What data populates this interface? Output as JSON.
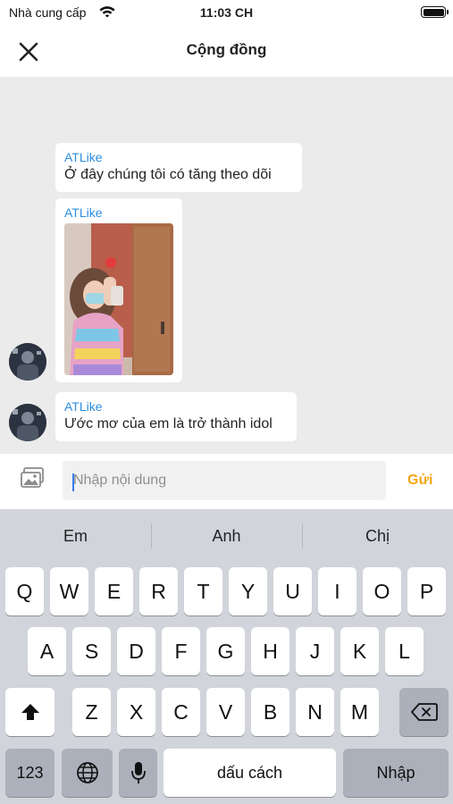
{
  "status_bar": {
    "carrier": "Nhà cung cấp",
    "time": "11:03 CH"
  },
  "nav": {
    "title": "Cộng đồng",
    "close_icon": "close-icon"
  },
  "messages": [
    {
      "sender": "ATLike",
      "text": "Ở đây chúng tôi có tăng theo dõi"
    },
    {
      "sender": "ATLike",
      "type": "image"
    },
    {
      "sender": "ATLike",
      "text": "Ước mơ của em là trở thành idol"
    }
  ],
  "composer": {
    "placeholder": "Nhập nội dung",
    "value": "",
    "send_label": "Gửi",
    "image_icon": "image-icon"
  },
  "keyboard": {
    "suggestions": [
      "Em",
      "Anh",
      "Chị"
    ],
    "row1": [
      "Q",
      "W",
      "E",
      "R",
      "T",
      "Y",
      "U",
      "I",
      "O",
      "P"
    ],
    "row2": [
      "A",
      "S",
      "D",
      "F",
      "G",
      "H",
      "J",
      "K",
      "L"
    ],
    "row3": [
      "Z",
      "X",
      "C",
      "V",
      "B",
      "N",
      "M"
    ],
    "numbers_label": "123",
    "space_label": "dấu cách",
    "return_label": "Nhập"
  },
  "colors": {
    "accent_sender": "#2e8ee0",
    "send": "#f4a60f",
    "chat_bg": "#ebebeb",
    "keyboard_bg": "#d1d4da"
  }
}
